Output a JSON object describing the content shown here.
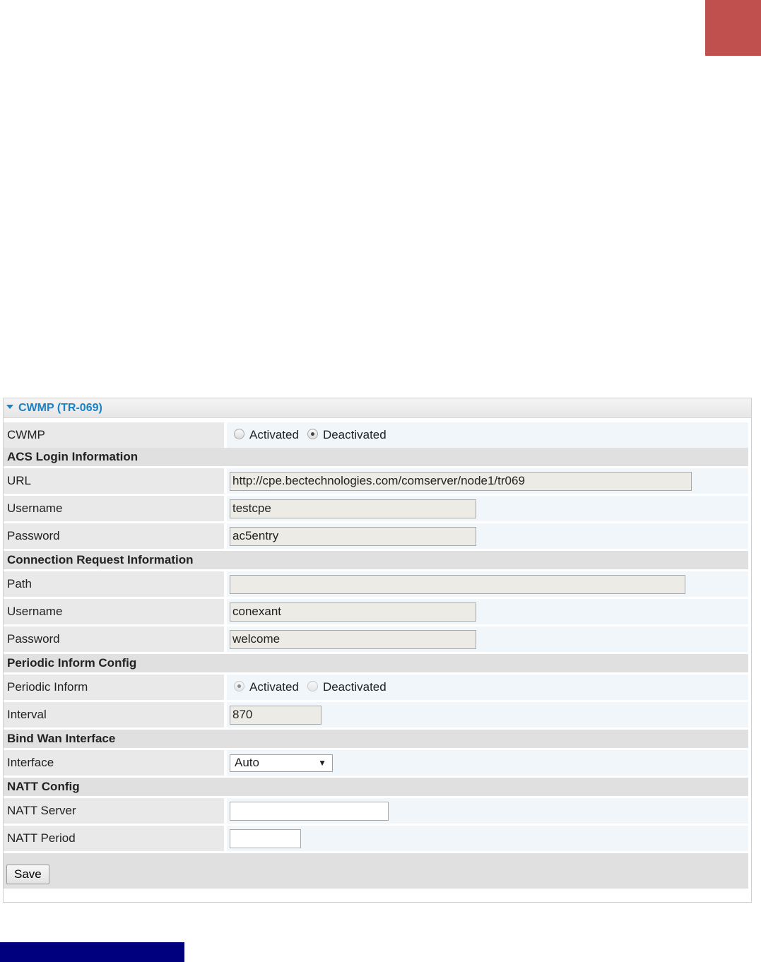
{
  "panel": {
    "title": "CWMP (TR-069)"
  },
  "cwmp": {
    "label": "CWMP",
    "options": [
      "Activated",
      "Deactivated"
    ],
    "selected": "Deactivated"
  },
  "acs": {
    "header": "ACS Login Information",
    "url": {
      "label": "URL",
      "value": "http://cpe.bectechnologies.com/comserver/node1/tr069"
    },
    "username": {
      "label": "Username",
      "value": "testcpe"
    },
    "password": {
      "label": "Password",
      "value": "ac5entry"
    }
  },
  "conn": {
    "header": "Connection Request Information",
    "path": {
      "label": "Path",
      "value": ""
    },
    "username": {
      "label": "Username",
      "value": "conexant"
    },
    "password": {
      "label": "Password",
      "value": "welcome"
    }
  },
  "periodic": {
    "header": "Periodic Inform Config",
    "inform": {
      "label": "Periodic Inform",
      "options": [
        "Activated",
        "Deactivated"
      ],
      "selected": "Activated"
    },
    "interval": {
      "label": "Interval",
      "value": "870"
    }
  },
  "bind": {
    "header": "Bind Wan Interface",
    "interface": {
      "label": "Interface",
      "value": "Auto"
    }
  },
  "natt": {
    "header": "NATT Config",
    "server": {
      "label": "NATT Server",
      "value": ""
    },
    "period": {
      "label": "NATT Period",
      "value": ""
    }
  },
  "actions": {
    "save_label": "Save"
  },
  "colors": {
    "accent": "#1a82c4",
    "corner_block": "#c0504d",
    "footer_bar": "#00007f"
  }
}
